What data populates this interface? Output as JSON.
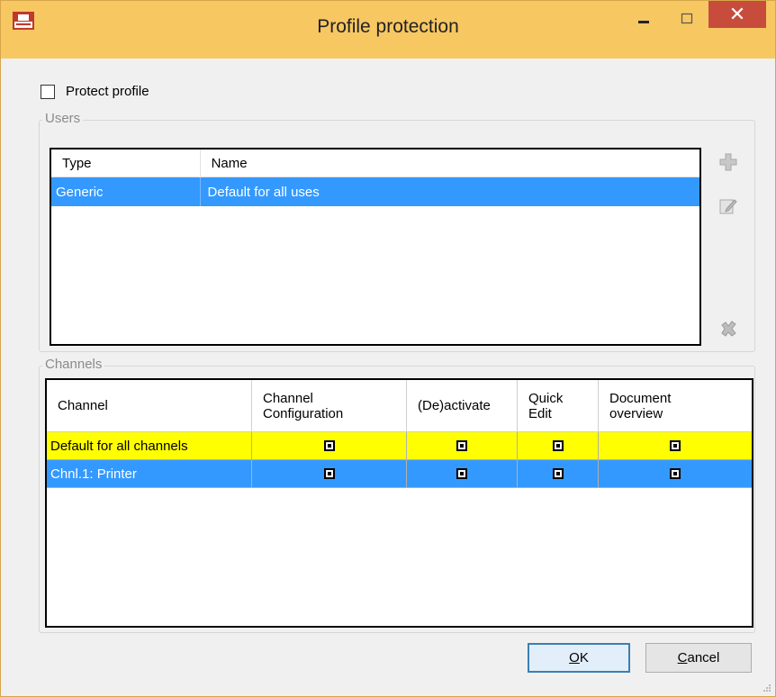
{
  "window": {
    "title": "Profile protection",
    "close_label": "✕",
    "colors": {
      "titlebar": "#f7c762",
      "close": "#c74c3c",
      "selection": "#3399ff",
      "highlight": "#ffff00"
    }
  },
  "protect_profile": {
    "label": "Protect profile",
    "checked": false
  },
  "users": {
    "group_title": "Users",
    "columns": [
      "Type",
      "Name"
    ],
    "rows": [
      {
        "type": "Generic",
        "name": "Default for all uses",
        "selected": true
      }
    ],
    "side_icons": [
      "add-icon",
      "edit-icon",
      "delete-icon"
    ]
  },
  "channels": {
    "group_title": "Channels",
    "columns": [
      "Channel",
      "Channel\nConfiguration",
      "(De)activate",
      "Quick\nEdit",
      "Document\noverview"
    ],
    "rows": [
      {
        "channel": "Default for all channels",
        "highlight": "yellow",
        "checks": [
          true,
          true,
          true,
          true
        ]
      },
      {
        "channel": "Chnl.1: Printer",
        "highlight": "blue",
        "checks": [
          true,
          true,
          true,
          true
        ]
      }
    ]
  },
  "buttons": {
    "ok_accel": "O",
    "ok_rest": "K",
    "cancel_accel": "C",
    "cancel_rest": "ancel"
  }
}
